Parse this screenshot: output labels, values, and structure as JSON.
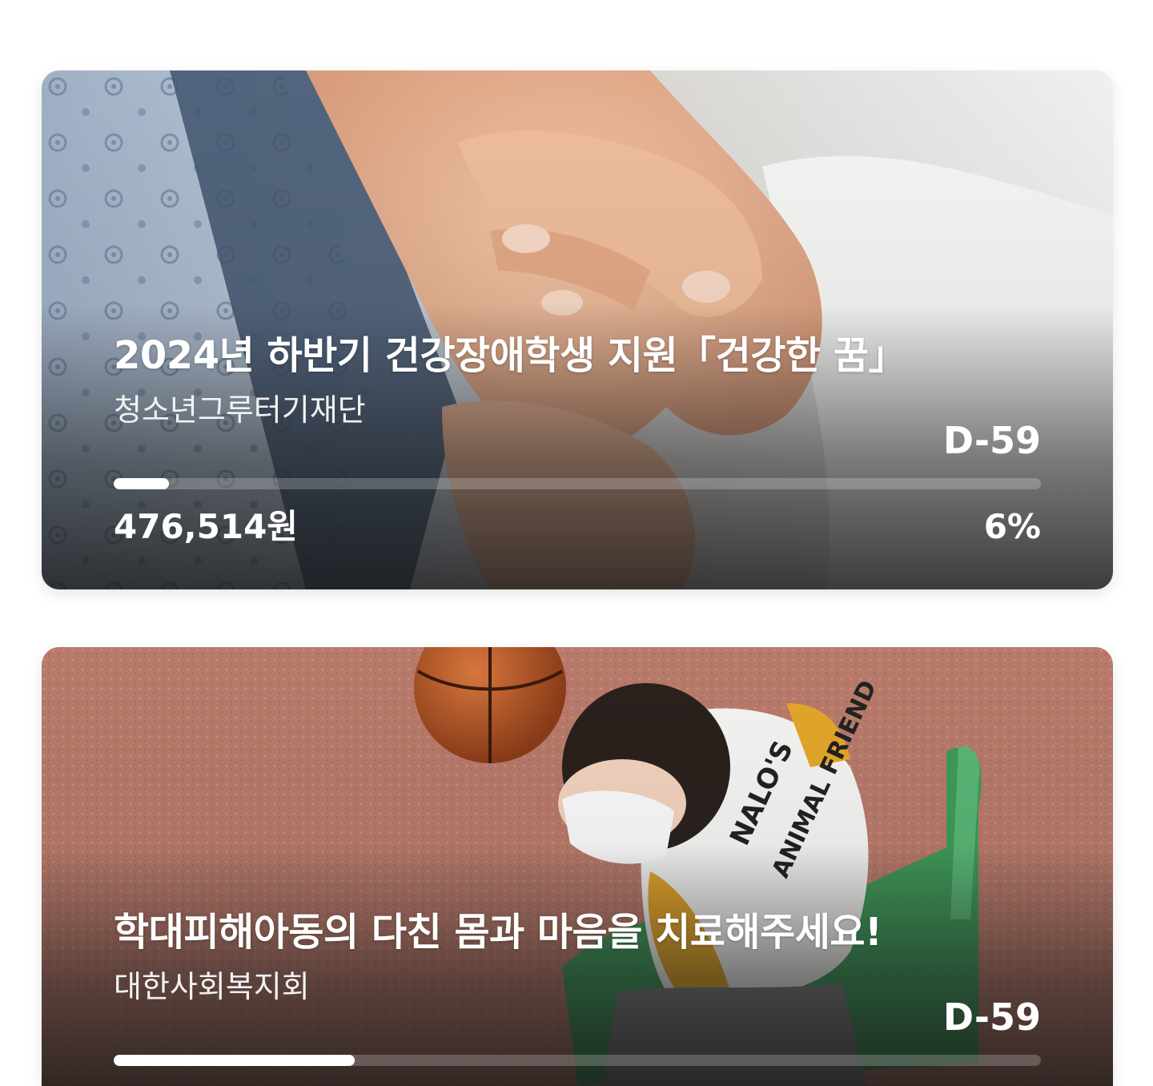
{
  "campaigns": [
    {
      "title": "2024년 하반기 건강장애학생 지원「건강한 꿈」",
      "organization": "청소년그루터기재단",
      "dday": "D-59",
      "amount": "476,514원",
      "percent": "6%",
      "progress": 0.06
    },
    {
      "title": "학대피해아동의 다친 몸과 마음을 치료해주세요!",
      "organization": "대한사회복지회",
      "dday": "D-59",
      "progress": 0.26
    }
  ],
  "colors": {
    "text": "#ffffff",
    "progress_track": "rgba(255,255,255,0.22)",
    "progress_fill": "#ffffff"
  }
}
